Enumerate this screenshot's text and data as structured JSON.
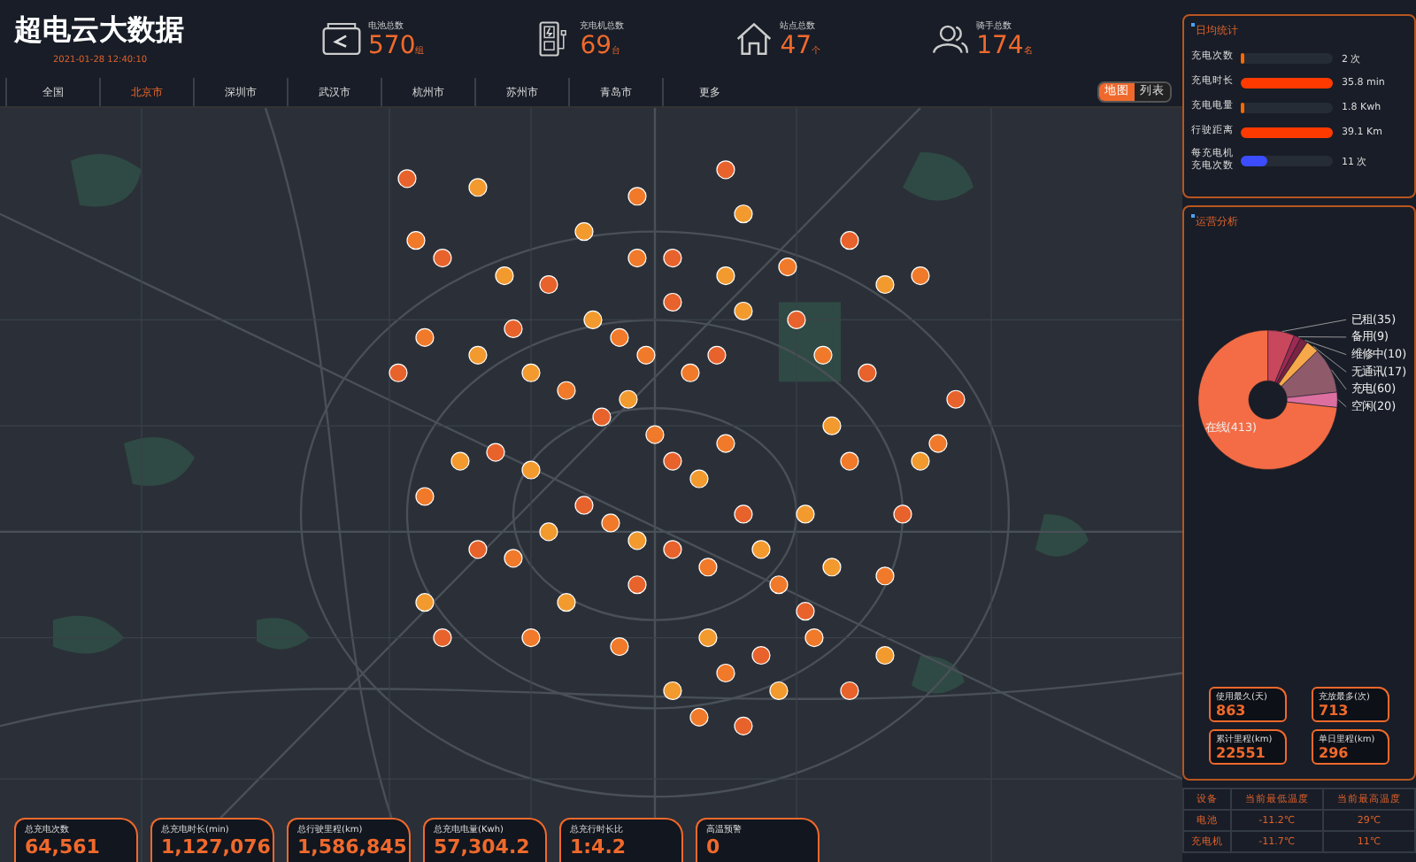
{
  "header": {
    "title": "超电云大数据",
    "datetime": "2021-01-28 12:40:10",
    "stats": [
      {
        "kind": "battery",
        "label": "电池总数",
        "value": "570",
        "unit": "组"
      },
      {
        "kind": "charger",
        "label": "充电机总数",
        "value": "69",
        "unit": "台"
      },
      {
        "kind": "house",
        "label": "站点总数",
        "value": "47",
        "unit": "个"
      },
      {
        "kind": "people",
        "label": "骑手总数",
        "value": "174",
        "unit": "名"
      }
    ]
  },
  "city_tabs": [
    {
      "label": "全国",
      "selected": false
    },
    {
      "label": "北京市",
      "selected": true
    },
    {
      "label": "深圳市",
      "selected": false
    },
    {
      "label": "武汉市",
      "selected": false
    },
    {
      "label": "杭州市",
      "selected": false
    },
    {
      "label": "苏州市",
      "selected": false
    },
    {
      "label": "青岛市",
      "selected": false
    },
    {
      "label": "更多",
      "selected": false
    }
  ],
  "view_toggle": [
    {
      "label": "地图",
      "selected": true
    },
    {
      "label": "列表",
      "selected": false
    }
  ],
  "totals": [
    {
      "label": "总充电次数",
      "value": "64,561"
    },
    {
      "label": "总充电时长(min)",
      "value": "1,127,076"
    },
    {
      "label": "总行驶里程(km)",
      "value": "1,586,845"
    },
    {
      "label": "总充电电量(Kwh)",
      "value": "57,304.2"
    },
    {
      "label": "总充行时长比",
      "value": "1:4.2"
    },
    {
      "label": "高温预警",
      "value": "0"
    }
  ],
  "daily": {
    "title": "日均统计",
    "rows": [
      {
        "label": "充电次数",
        "level": 0.04,
        "color": "#ff6a00",
        "reading": "2 次"
      },
      {
        "label": "充电时长",
        "level": 1,
        "color": "#ff3a00",
        "reading": "35.8 min"
      },
      {
        "label": "充电电量",
        "level": 0.04,
        "color": "#ff6a00",
        "reading": "1.8 Kwh"
      },
      {
        "label": "行驶距离",
        "level": 1,
        "color": "#ff3a00",
        "reading": "39.1 Km"
      },
      {
        "label": "每充电机充电次数",
        "level": 0.28,
        "color": "#3b4dff",
        "reading": "11 次"
      }
    ]
  },
  "operations": {
    "title": "运营分析",
    "chart_data": {
      "type": "donut",
      "categories": [
        "已租(35)",
        "备用(9)",
        "维修中(10)",
        "无通讯(17)",
        "充电(60)",
        "空闲(20)",
        "在线(413)"
      ],
      "values": [
        35,
        9,
        10,
        17,
        60,
        20,
        413
      ]
    },
    "metrics": [
      {
        "label": "使用最久(天)",
        "value": "863"
      },
      {
        "label": "充放最多(次)",
        "value": "713"
      },
      {
        "label": "累计里程(km)",
        "value": "22551"
      },
      {
        "label": "单日里程(km)",
        "value": "296"
      }
    ]
  },
  "temperature_table": {
    "columns": [
      "设备",
      "当前最低温度",
      "当前最高温度"
    ],
    "rows": [
      [
        "电池",
        "-11.2℃",
        "29℃"
      ],
      [
        "充电机",
        "-11.7℃",
        "11℃"
      ]
    ]
  }
}
